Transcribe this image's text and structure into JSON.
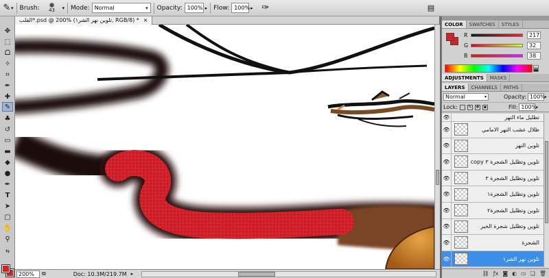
{
  "options_bar": {
    "brush_label": "Brush:",
    "brush_size": "43",
    "mode_label": "Mode:",
    "mode_value": "Normal",
    "opacity_label": "Opacity:",
    "opacity_value": "100%",
    "flow_label": "Flow:",
    "flow_value": "100%"
  },
  "document": {
    "tab_title": "القلب*.psd @ 200% (تلوين نهر الشر١, RGB/8) *",
    "zoom": "200%",
    "doc_size": "Doc: 10.3M/219.7M"
  },
  "color_panel": {
    "tabs": [
      "COLOR",
      "SWATCHES",
      "STYLES"
    ],
    "active_tab": "COLOR",
    "r_label": "R",
    "r_value": "217",
    "g_label": "G",
    "g_value": "32",
    "b_label": "B",
    "b_value": "38",
    "foreground_color": "#d92026"
  },
  "adjust_panel": {
    "tabs": [
      "ADJUSTMENTS",
      "MASKS"
    ]
  },
  "layers_panel": {
    "tabs": [
      "LAYERS",
      "CHANNELS",
      "PATHS"
    ],
    "blend_mode": "Normal",
    "opacity_label": "Opacity:",
    "opacity_value": "100%",
    "lock_label": "Lock:",
    "fill_label": "Fill:",
    "fill_value": "100%",
    "layers": [
      {
        "name": "تظليل ماء النهر",
        "selected": false
      },
      {
        "name": "ظلال عشب النهر الامامي",
        "selected": false
      },
      {
        "name": "تلوين النهر",
        "selected": false
      },
      {
        "name": "تلوين وتظليل الشجرة ٣ copy",
        "selected": false
      },
      {
        "name": "تلوين وتظليل الشجرة ٣",
        "selected": false
      },
      {
        "name": "تلوين وتظليل الشجرة١",
        "selected": false
      },
      {
        "name": "تلوين وتظليل الشجرة٢",
        "selected": false
      },
      {
        "name": "تلوين وتظليل شجرة الخير",
        "selected": false
      },
      {
        "name": "الشجرة",
        "selected": false
      },
      {
        "name": "تلوين نهر الشر١",
        "selected": true
      }
    ]
  }
}
